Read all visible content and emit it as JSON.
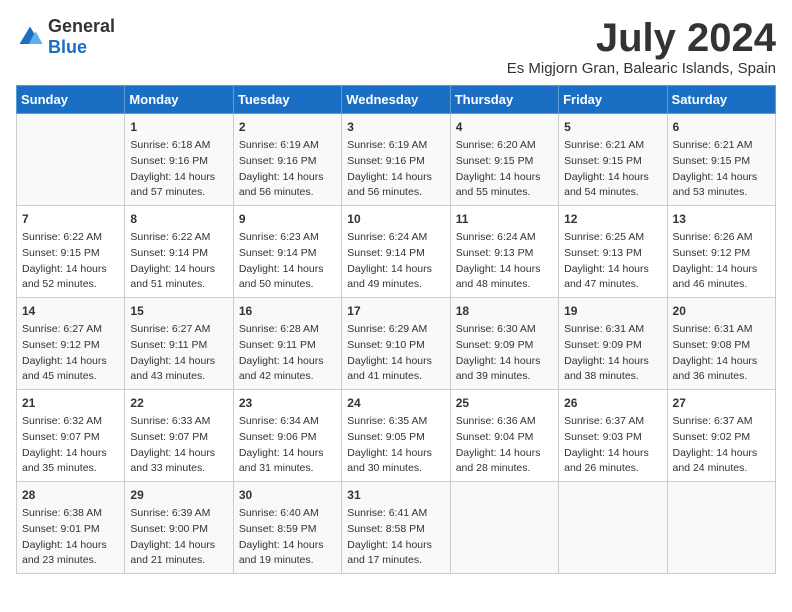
{
  "logo": {
    "general": "General",
    "blue": "Blue"
  },
  "title": "July 2024",
  "location": "Es Migjorn Gran, Balearic Islands, Spain",
  "headers": [
    "Sunday",
    "Monday",
    "Tuesday",
    "Wednesday",
    "Thursday",
    "Friday",
    "Saturday"
  ],
  "weeks": [
    [
      {
        "day": "",
        "sunrise": "",
        "sunset": "",
        "daylight": ""
      },
      {
        "day": "1",
        "sunrise": "Sunrise: 6:18 AM",
        "sunset": "Sunset: 9:16 PM",
        "daylight": "Daylight: 14 hours and 57 minutes."
      },
      {
        "day": "2",
        "sunrise": "Sunrise: 6:19 AM",
        "sunset": "Sunset: 9:16 PM",
        "daylight": "Daylight: 14 hours and 56 minutes."
      },
      {
        "day": "3",
        "sunrise": "Sunrise: 6:19 AM",
        "sunset": "Sunset: 9:16 PM",
        "daylight": "Daylight: 14 hours and 56 minutes."
      },
      {
        "day": "4",
        "sunrise": "Sunrise: 6:20 AM",
        "sunset": "Sunset: 9:15 PM",
        "daylight": "Daylight: 14 hours and 55 minutes."
      },
      {
        "day": "5",
        "sunrise": "Sunrise: 6:21 AM",
        "sunset": "Sunset: 9:15 PM",
        "daylight": "Daylight: 14 hours and 54 minutes."
      },
      {
        "day": "6",
        "sunrise": "Sunrise: 6:21 AM",
        "sunset": "Sunset: 9:15 PM",
        "daylight": "Daylight: 14 hours and 53 minutes."
      }
    ],
    [
      {
        "day": "7",
        "sunrise": "Sunrise: 6:22 AM",
        "sunset": "Sunset: 9:15 PM",
        "daylight": "Daylight: 14 hours and 52 minutes."
      },
      {
        "day": "8",
        "sunrise": "Sunrise: 6:22 AM",
        "sunset": "Sunset: 9:14 PM",
        "daylight": "Daylight: 14 hours and 51 minutes."
      },
      {
        "day": "9",
        "sunrise": "Sunrise: 6:23 AM",
        "sunset": "Sunset: 9:14 PM",
        "daylight": "Daylight: 14 hours and 50 minutes."
      },
      {
        "day": "10",
        "sunrise": "Sunrise: 6:24 AM",
        "sunset": "Sunset: 9:14 PM",
        "daylight": "Daylight: 14 hours and 49 minutes."
      },
      {
        "day": "11",
        "sunrise": "Sunrise: 6:24 AM",
        "sunset": "Sunset: 9:13 PM",
        "daylight": "Daylight: 14 hours and 48 minutes."
      },
      {
        "day": "12",
        "sunrise": "Sunrise: 6:25 AM",
        "sunset": "Sunset: 9:13 PM",
        "daylight": "Daylight: 14 hours and 47 minutes."
      },
      {
        "day": "13",
        "sunrise": "Sunrise: 6:26 AM",
        "sunset": "Sunset: 9:12 PM",
        "daylight": "Daylight: 14 hours and 46 minutes."
      }
    ],
    [
      {
        "day": "14",
        "sunrise": "Sunrise: 6:27 AM",
        "sunset": "Sunset: 9:12 PM",
        "daylight": "Daylight: 14 hours and 45 minutes."
      },
      {
        "day": "15",
        "sunrise": "Sunrise: 6:27 AM",
        "sunset": "Sunset: 9:11 PM",
        "daylight": "Daylight: 14 hours and 43 minutes."
      },
      {
        "day": "16",
        "sunrise": "Sunrise: 6:28 AM",
        "sunset": "Sunset: 9:11 PM",
        "daylight": "Daylight: 14 hours and 42 minutes."
      },
      {
        "day": "17",
        "sunrise": "Sunrise: 6:29 AM",
        "sunset": "Sunset: 9:10 PM",
        "daylight": "Daylight: 14 hours and 41 minutes."
      },
      {
        "day": "18",
        "sunrise": "Sunrise: 6:30 AM",
        "sunset": "Sunset: 9:09 PM",
        "daylight": "Daylight: 14 hours and 39 minutes."
      },
      {
        "day": "19",
        "sunrise": "Sunrise: 6:31 AM",
        "sunset": "Sunset: 9:09 PM",
        "daylight": "Daylight: 14 hours and 38 minutes."
      },
      {
        "day": "20",
        "sunrise": "Sunrise: 6:31 AM",
        "sunset": "Sunset: 9:08 PM",
        "daylight": "Daylight: 14 hours and 36 minutes."
      }
    ],
    [
      {
        "day": "21",
        "sunrise": "Sunrise: 6:32 AM",
        "sunset": "Sunset: 9:07 PM",
        "daylight": "Daylight: 14 hours and 35 minutes."
      },
      {
        "day": "22",
        "sunrise": "Sunrise: 6:33 AM",
        "sunset": "Sunset: 9:07 PM",
        "daylight": "Daylight: 14 hours and 33 minutes."
      },
      {
        "day": "23",
        "sunrise": "Sunrise: 6:34 AM",
        "sunset": "Sunset: 9:06 PM",
        "daylight": "Daylight: 14 hours and 31 minutes."
      },
      {
        "day": "24",
        "sunrise": "Sunrise: 6:35 AM",
        "sunset": "Sunset: 9:05 PM",
        "daylight": "Daylight: 14 hours and 30 minutes."
      },
      {
        "day": "25",
        "sunrise": "Sunrise: 6:36 AM",
        "sunset": "Sunset: 9:04 PM",
        "daylight": "Daylight: 14 hours and 28 minutes."
      },
      {
        "day": "26",
        "sunrise": "Sunrise: 6:37 AM",
        "sunset": "Sunset: 9:03 PM",
        "daylight": "Daylight: 14 hours and 26 minutes."
      },
      {
        "day": "27",
        "sunrise": "Sunrise: 6:37 AM",
        "sunset": "Sunset: 9:02 PM",
        "daylight": "Daylight: 14 hours and 24 minutes."
      }
    ],
    [
      {
        "day": "28",
        "sunrise": "Sunrise: 6:38 AM",
        "sunset": "Sunset: 9:01 PM",
        "daylight": "Daylight: 14 hours and 23 minutes."
      },
      {
        "day": "29",
        "sunrise": "Sunrise: 6:39 AM",
        "sunset": "Sunset: 9:00 PM",
        "daylight": "Daylight: 14 hours and 21 minutes."
      },
      {
        "day": "30",
        "sunrise": "Sunrise: 6:40 AM",
        "sunset": "Sunset: 8:59 PM",
        "daylight": "Daylight: 14 hours and 19 minutes."
      },
      {
        "day": "31",
        "sunrise": "Sunrise: 6:41 AM",
        "sunset": "Sunset: 8:58 PM",
        "daylight": "Daylight: 14 hours and 17 minutes."
      },
      {
        "day": "",
        "sunrise": "",
        "sunset": "",
        "daylight": ""
      },
      {
        "day": "",
        "sunrise": "",
        "sunset": "",
        "daylight": ""
      },
      {
        "day": "",
        "sunrise": "",
        "sunset": "",
        "daylight": ""
      }
    ]
  ]
}
